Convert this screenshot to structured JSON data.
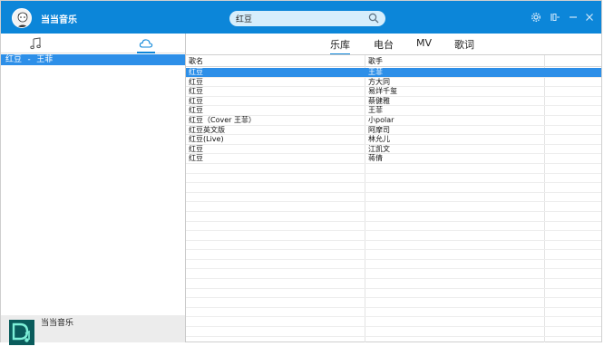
{
  "app": {
    "title": "当当音乐"
  },
  "search": {
    "value": "红豆",
    "icon": "search-icon"
  },
  "titlebar": {
    "icons": [
      "gear-icon",
      "mini-mode-icon",
      "minimize-icon",
      "close-icon"
    ]
  },
  "sidebar": {
    "tabs": [
      "music-note-icon",
      "cloud-icon"
    ],
    "playlist": [
      {
        "label": "红豆 - 王菲"
      }
    ]
  },
  "player": {
    "name": "当当音乐"
  },
  "main": {
    "tabs": [
      {
        "label": "乐库",
        "active": true
      },
      {
        "label": "电台",
        "active": false
      },
      {
        "label": "MV",
        "active": false
      },
      {
        "label": "歌词",
        "active": false
      }
    ],
    "columns": {
      "song": "歌名",
      "artist": "歌手"
    },
    "rows": [
      {
        "song": "红豆",
        "artist": "王菲",
        "selected": true
      },
      {
        "song": "红豆",
        "artist": "方大同"
      },
      {
        "song": "红豆",
        "artist": "易烊千玺"
      },
      {
        "song": "红豆",
        "artist": "蔡健雅"
      },
      {
        "song": "红豆",
        "artist": "王菲"
      },
      {
        "song": "红豆（Cover 王菲）",
        "artist": "小polar"
      },
      {
        "song": "红豆英文版",
        "artist": "阿摩司"
      },
      {
        "song": "红豆(Live)",
        "artist": "林允儿"
      },
      {
        "song": "红豆",
        "artist": "江凯文"
      },
      {
        "song": "红豆",
        "artist": "蒋倩"
      }
    ]
  },
  "colors": {
    "accent": "#0c86d9",
    "selection": "#2d8fe8"
  }
}
